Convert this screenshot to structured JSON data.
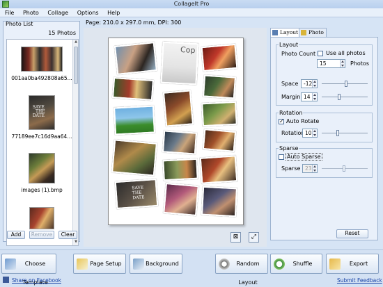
{
  "window": {
    "title": "CollageIt Pro"
  },
  "menu": [
    "File",
    "Photo",
    "Collage",
    "Options",
    "Help"
  ],
  "photo_panel": {
    "title": "Photo List",
    "count": "15 Photos",
    "items": [
      {
        "label": "001aa0ba492808a65..."
      },
      {
        "label": "77189ee7c16d9aa64..."
      },
      {
        "label": "images (1).bmp"
      },
      {
        "label": ""
      }
    ],
    "add_label": "Add",
    "remove_label": "Remove",
    "clear_label": "Clear"
  },
  "canvas": {
    "page_info": "Page: 210.0 x 297.0 mm, DPI: 300",
    "copy_text": "Cop"
  },
  "tabs": {
    "layout": "Layout",
    "photo": "Photo"
  },
  "layout": {
    "title": "Layout",
    "photo_count_label": "Photo Count",
    "use_all_label": "Use all photos",
    "photo_count_value": "15",
    "photos_unit": "Photos",
    "space_label": "Space",
    "space_value": "-12",
    "margin_label": "Margin",
    "margin_value": "14"
  },
  "rotation": {
    "title": "Rotation",
    "auto_rotate_label": "Auto Rotate",
    "rotation_label": "Rotation",
    "rotation_value": "10"
  },
  "sparse": {
    "title": "Sparse",
    "auto_sparse_label": "Auto Sparse",
    "sparse_label": "Sparse",
    "sparse_value": "23"
  },
  "reset_label": "Reset",
  "bottom": {
    "choose_template": "Choose Template",
    "page_setup": "Page Setup",
    "background": "Background",
    "random_layout": "Random Layout",
    "shuffle": "Shuffle",
    "export": "Export",
    "share_link": "Share on Facebook",
    "feedback_link": "Submit Feedback"
  },
  "thumb_text": {
    "save_the_date_1": "SAVE",
    "save_the_date_2": "THE",
    "save_the_date_3": "DATE"
  }
}
